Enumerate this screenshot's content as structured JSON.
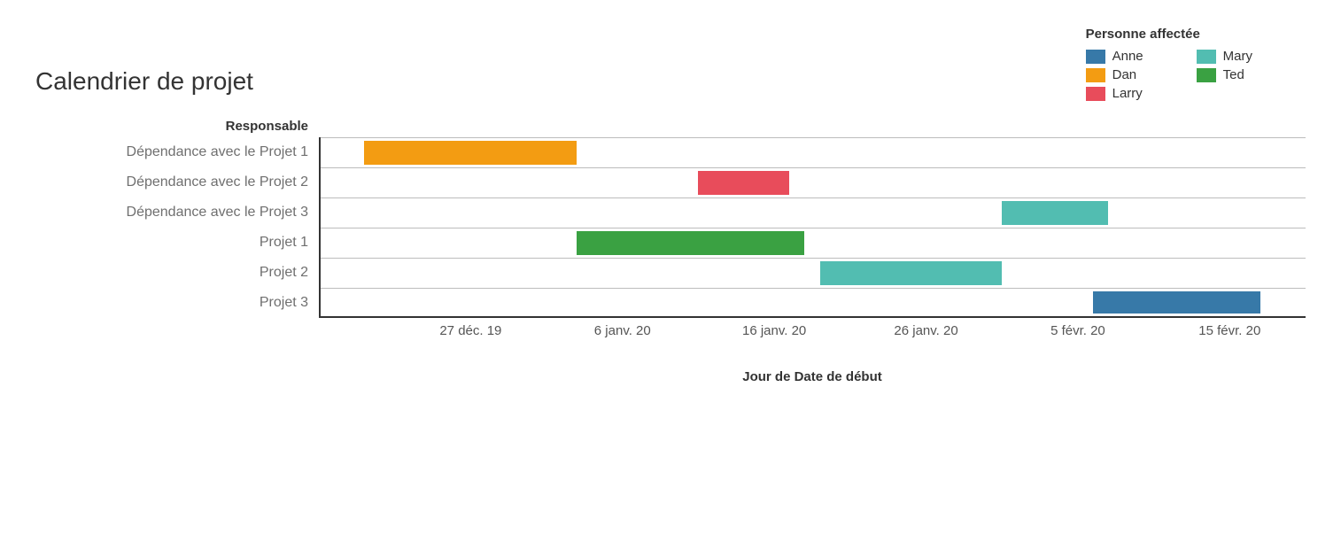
{
  "title": "Calendrier de projet",
  "row_header": "Responsable",
  "x_axis_title": "Jour de Date de début",
  "legend": {
    "title": "Personne affectée",
    "items": [
      {
        "name": "Anne",
        "color": "#3779a8"
      },
      {
        "name": "Dan",
        "color": "#f39c12"
      },
      {
        "name": "Larry",
        "color": "#e84c5b"
      },
      {
        "name": "Mary",
        "color": "#52bdb1"
      },
      {
        "name": "Ted",
        "color": "#3aa142"
      }
    ]
  },
  "chart_data": {
    "type": "bar",
    "orientation": "gantt",
    "x_domain": [
      "2019-12-17",
      "2020-02-20"
    ],
    "x_ticks": [
      {
        "label": "27 déc. 19",
        "date": "2019-12-27"
      },
      {
        "label": "6 janv. 20",
        "date": "2020-01-06"
      },
      {
        "label": "16 janv. 20",
        "date": "2020-01-16"
      },
      {
        "label": "26 janv. 20",
        "date": "2020-01-26"
      },
      {
        "label": "5 févr. 20",
        "date": "2020-02-05"
      },
      {
        "label": "15 févr. 20",
        "date": "2020-02-15"
      }
    ],
    "rows": [
      {
        "label": "Dépendance avec le Projet 1",
        "start": "2019-12-20",
        "end": "2020-01-03",
        "person": "Dan",
        "color": "#f39c12"
      },
      {
        "label": "Dépendance avec le Projet 2",
        "start": "2020-01-11",
        "end": "2020-01-17",
        "person": "Larry",
        "color": "#e84c5b"
      },
      {
        "label": "Dépendance avec le Projet 3",
        "start": "2020-01-31",
        "end": "2020-02-07",
        "person": "Mary",
        "color": "#52bdb1"
      },
      {
        "label": "Projet 1",
        "start": "2020-01-03",
        "end": "2020-01-18",
        "person": "Ted",
        "color": "#3aa142"
      },
      {
        "label": "Projet 2",
        "start": "2020-01-19",
        "end": "2020-01-31",
        "person": "Mary",
        "color": "#52bdb1"
      },
      {
        "label": "Projet 3",
        "start": "2020-02-06",
        "end": "2020-02-17",
        "person": "Anne",
        "color": "#3779a8"
      }
    ]
  }
}
